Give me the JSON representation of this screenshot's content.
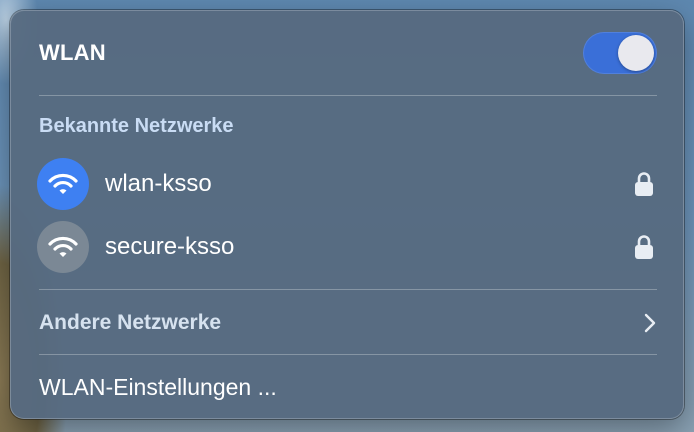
{
  "wlan_menu": {
    "title": "WLAN",
    "toggle_on": true,
    "known_networks_title": "Bekannte Netzwerke",
    "known_networks": [
      {
        "name": "wlan-ksso",
        "connected": true,
        "secured": true,
        "icon": "wifi-icon"
      },
      {
        "name": "secure-ksso",
        "connected": false,
        "secured": true,
        "icon": "wifi-icon"
      }
    ],
    "other_networks_label": "Andere Netzwerke",
    "settings_label": "WLAN-Einstellungen ...",
    "colors": {
      "accent": "#3e80f2",
      "toggle": "#3a6fd8",
      "panel": "#566a80"
    }
  }
}
